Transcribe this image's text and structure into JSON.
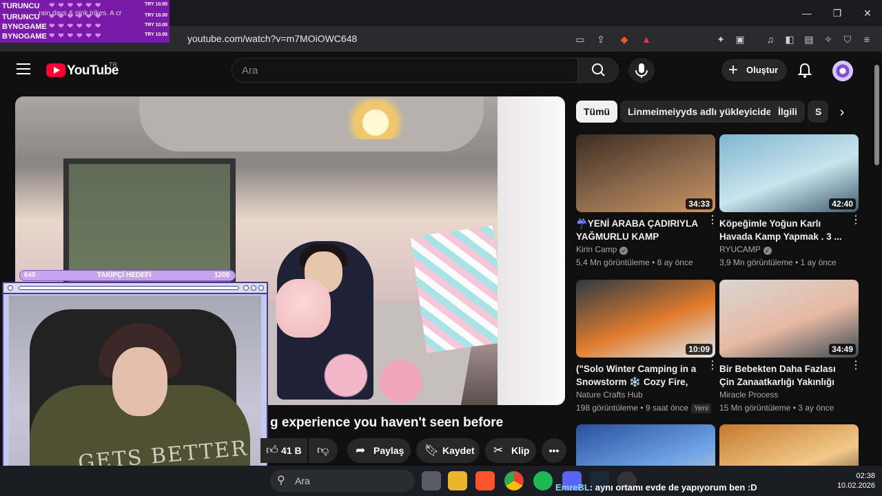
{
  "browser": {
    "url": "youtube.com/watch?v=m7MOiOWC648",
    "window_controls": [
      "minimize",
      "maximize",
      "close"
    ]
  },
  "header": {
    "logo_text": "YouTube",
    "region": "TR",
    "search_placeholder": "Ara",
    "create_label": "Oluştur"
  },
  "video": {
    "title_visible": "g experience you haven't seen before",
    "like_count": "41 B",
    "share_label": "Paylaş",
    "save_label": "Kaydet",
    "clip_label": "Klip"
  },
  "chips": [
    {
      "label": "Tümü",
      "active": true
    },
    {
      "label": "Linmeimeiyyds adlı yükleyiciden",
      "active": false
    },
    {
      "label": "İlgili",
      "active": false
    },
    {
      "label": "S",
      "active": false
    }
  ],
  "recommendations": [
    {
      "title": "☔YENİ ARABA ÇADIRIYLA YAĞMURLU KAMP",
      "channel": "Kirin Camp",
      "verified": true,
      "meta": "5,4 Mn görüntüleme • 8 ay önce",
      "duration": "34:33",
      "thumb_colors": [
        "#3d2c22",
        "#8c6a4c",
        "#c99363"
      ]
    },
    {
      "title": "Köpeğimle Yoğun Karlı Havada Kamp Yapmak . 3 ...",
      "channel": "RYUCAMP",
      "verified": true,
      "meta": "3,9 Mn görüntüleme • 1 ay önce",
      "duration": "42:40",
      "thumb_colors": [
        "#7fb6cf",
        "#c9e4ee",
        "#3d5c6b"
      ]
    },
    {
      "title": "(\"Solo Winter Camping in a Snowstorm ❄️ Cozy Fire, Ho...",
      "channel": "Nature Crafts Hub",
      "verified": false,
      "meta": "198 görüntüleme • 9 saat önce",
      "badge": "Yeni",
      "duration": "10:09",
      "thumb_colors": [
        "#2c3a44",
        "#e07b2d",
        "#dfe9ef"
      ]
    },
    {
      "title": "Bir Bebekten Daha Fazlası Çin Zanaatkarlığı Yakınlığı Nasıl ...",
      "channel": "Miracle Process",
      "verified": false,
      "meta": "15 Mn görüntüleme • 3 ay önce",
      "duration": "34:49",
      "thumb_colors": [
        "#d9d5d0",
        "#e7b9a3",
        "#3c4a52"
      ]
    },
    {
      "title": "",
      "channel": "",
      "verified": false,
      "meta": "",
      "duration": "",
      "thumb_colors": [
        "#2a4f9c",
        "#6fa4e6",
        "#e9d2c8"
      ]
    },
    {
      "title": "",
      "channel": "",
      "verified": false,
      "meta": "",
      "duration": "",
      "thumb_colors": [
        "#c57a2c",
        "#f2c98a",
        "#3b2318"
      ]
    }
  ],
  "overlay": {
    "ticker": [
      {
        "name": "TURUNCU",
        "price": "TRY 10.00"
      },
      {
        "name": "TURUNCU",
        "price": "TRY 10.00"
      },
      {
        "name": "BYNOGAME",
        "price": "TRY 10.00"
      },
      {
        "name": "BYNOGAME",
        "price": "TRY 10.00"
      }
    ],
    "ticker_sub": "...rain days & pink trikes. A cr",
    "goal_start": "640",
    "goal_label": "TAKİPÇİ HEDEFİ",
    "goal_end": "1200",
    "cam_shirt_text": "GETS BETTER"
  },
  "taskbar": {
    "search_placeholder": "Ara",
    "time": "02:38",
    "date": "10.02.2026",
    "chat_user": "EmreBL",
    "chat_message": ": aynı ortamı evde de yapıyorum ben :D"
  }
}
